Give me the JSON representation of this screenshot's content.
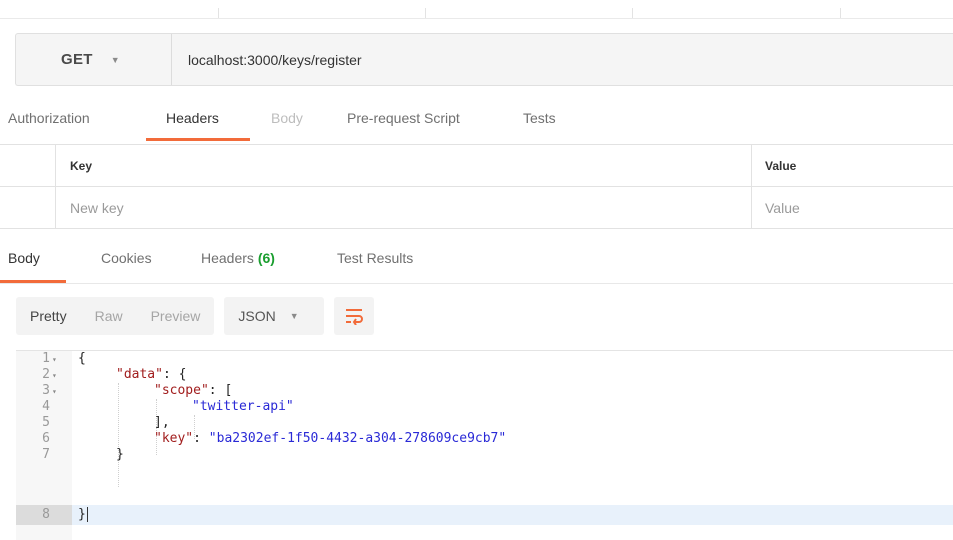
{
  "request": {
    "method": "GET",
    "url": "localhost:3000/keys/register",
    "tabs": [
      "Authorization",
      "Headers",
      "Body",
      "Pre-request Script",
      "Tests"
    ],
    "active_tab": "Headers"
  },
  "headers_table": {
    "columns": [
      "Key",
      "Value"
    ],
    "placeholder_key": "New key",
    "placeholder_value": "Value"
  },
  "response": {
    "tabs": [
      {
        "label": "Body"
      },
      {
        "label": "Cookies"
      },
      {
        "label": "Headers",
        "count": "(6)"
      },
      {
        "label": "Test Results"
      }
    ],
    "active_tab": "Body",
    "view_modes": [
      "Pretty",
      "Raw",
      "Preview"
    ],
    "active_view": "Pretty",
    "format": "JSON",
    "wrap_icon": "wrap-lines-icon"
  },
  "editor": {
    "lines": [
      {
        "n": "1",
        "fold": true,
        "text": "{"
      },
      {
        "n": "2",
        "fold": true,
        "key": "\"data\"",
        "rest": ": {"
      },
      {
        "n": "3",
        "fold": true,
        "key": "\"scope\"",
        "rest": ": ["
      },
      {
        "n": "4",
        "fold": false,
        "val": "\"twitter-api\""
      },
      {
        "n": "5",
        "fold": false,
        "text": "],"
      },
      {
        "n": "6",
        "fold": false,
        "key": "\"key\"",
        "rest": ": ",
        "val": "\"ba2302ef-1f50-4432-a304-278609ce9cb7\""
      },
      {
        "n": "7",
        "fold": false,
        "text": "}"
      },
      {
        "n": "8",
        "fold": false,
        "text": "}"
      }
    ],
    "current_line": "8"
  },
  "colors": {
    "accent": "#f26b3a",
    "count_green": "#1a9e2f",
    "json_key": "#a11d1d",
    "json_value": "#2a2ad6"
  }
}
